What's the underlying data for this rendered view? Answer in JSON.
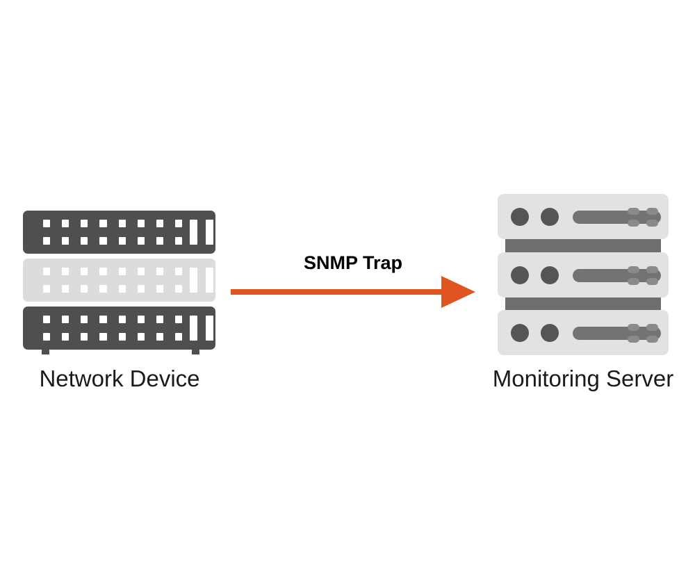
{
  "diagram": {
    "title": "SNMP Trap flow",
    "background_color": "#ffffff",
    "nodes": {
      "left": {
        "caption": "Network Device",
        "icon": "network-switch-icon",
        "layer_count": 3,
        "layer_colors": [
          "#4f4f4f",
          "#dcdcdc",
          "#4f4f4f"
        ],
        "port_columns": 8,
        "port_rows": 2,
        "uplink_bars": 2,
        "port_color": "#ffffff"
      },
      "right": {
        "caption": "Monitoring Server",
        "icon": "server-rack-icon",
        "unit_count": 3,
        "unit_color": "#e2e2e2",
        "separator_color": "#6e6e6e",
        "led_color": "#555555",
        "slot_color": "#737373",
        "dot_color": "#8a8a8a",
        "leds_per_unit": 2,
        "dots_per_unit": 4
      }
    },
    "connector": {
      "label": "SNMP Trap",
      "direction": "left-to-right",
      "color": "#e0551f",
      "label_color": "#000000",
      "line_thickness_px": 8
    },
    "caption_color": "#1a1a1a"
  }
}
